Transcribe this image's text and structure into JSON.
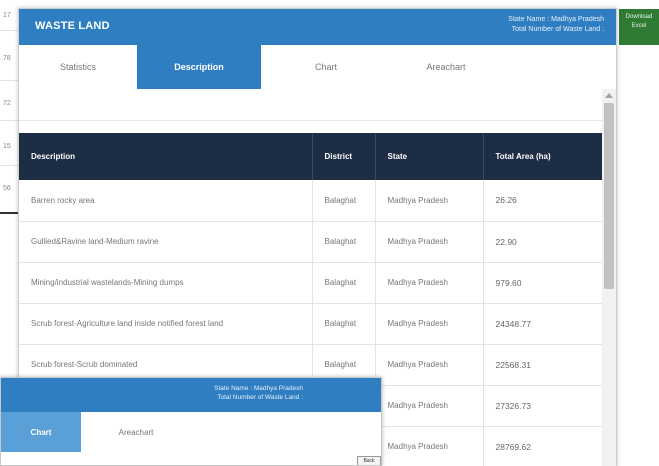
{
  "background": {
    "row_numbers": [
      "17",
      "78",
      "72",
      "15",
      "56"
    ]
  },
  "download_button": {
    "label": "Download Excel"
  },
  "modal": {
    "title": "WASTE LAND",
    "state_name": "State Name : Madhya Pradesh",
    "total_number": "Total Number of Waste Land :",
    "tabs": [
      {
        "label": "Statistics",
        "active": false
      },
      {
        "label": "Description",
        "active": true
      },
      {
        "label": "Chart",
        "active": false
      },
      {
        "label": "Areachart",
        "active": false
      }
    ],
    "table": {
      "columns": [
        "Description",
        "District",
        "State",
        "Total Area (ha)"
      ],
      "rows": [
        [
          "Barren rocky area",
          "Balaghat",
          "Madhya Pradesh",
          "26.26"
        ],
        [
          "Gullied&Ravine land-Medium ravine",
          "Balaghat",
          "Madhya Pradesh",
          "22.90"
        ],
        [
          "Mining/industrial wastelands-Mining dumps",
          "Balaghat",
          "Madhya Pradesh",
          "979.60"
        ],
        [
          "Scrub forest-Agriculture land inside notified forest land",
          "Balaghat",
          "Madhya Pradesh",
          "24348.77"
        ],
        [
          "Scrub forest-Scrub dominated",
          "Balaghat",
          "Madhya Pradesh",
          "22568.31"
        ],
        [
          "",
          "",
          "Madhya Pradesh",
          "27326.73"
        ],
        [
          "",
          "",
          "Madhya Pradesh",
          "28769.62"
        ]
      ]
    }
  },
  "modal2": {
    "state_name": "State Name : Madhya Pradesh",
    "total_number": "Total Number of Waste Land :",
    "tabs": [
      {
        "label": "Chart",
        "active": true
      },
      {
        "label": "Areachart",
        "active": false
      }
    ],
    "back_label": "Back"
  },
  "colors": {
    "header_blue": "#2f7ec1",
    "table_header": "#1d2d44",
    "download_green": "#2f7b33"
  }
}
